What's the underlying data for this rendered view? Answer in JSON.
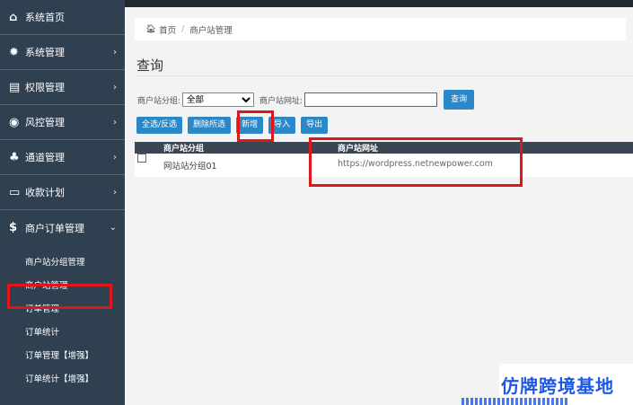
{
  "sidebar": {
    "items": [
      {
        "label": "系统首页",
        "icon": "home-icon"
      },
      {
        "label": "系统管理",
        "icon": "gear-icon"
      },
      {
        "label": "权限管理",
        "icon": "keyboard-icon"
      },
      {
        "label": "风控管理",
        "icon": "target-icon"
      },
      {
        "label": "通道管理",
        "icon": "sitemap-icon"
      },
      {
        "label": "收款计划",
        "icon": "calendar-icon"
      },
      {
        "label": "商户订单管理",
        "icon": "dollar-circle-icon"
      }
    ],
    "sub_items": [
      {
        "label": "商户站分组管理"
      },
      {
        "label": "商户站管理"
      },
      {
        "label": "订单管理"
      },
      {
        "label": "订单统计"
      },
      {
        "label": "订单管理【增强】"
      },
      {
        "label": "订单统计【增强】"
      }
    ],
    "chevron_right": "›",
    "chevron_down": "⌄"
  },
  "breadcrumb": {
    "home": "首页",
    "separator": "/",
    "current": "商户站管理"
  },
  "page_title": "查询",
  "filter": {
    "group_label": "商户站分组:",
    "group_selected": "全部",
    "url_label": "商户站网址:",
    "url_value": "",
    "search_button": "查询"
  },
  "toolbar": {
    "select_all": "全选/反选",
    "delete_selected": "删除所选",
    "add_new": "新增",
    "import": "导入",
    "export": "导出"
  },
  "table": {
    "columns": [
      "商户站分组",
      "商户站网址"
    ],
    "rows": [
      {
        "group": "网站站分组01",
        "url": "https://wordpress.netnewpower.com"
      }
    ]
  },
  "watermark": {
    "text": "仿牌跨境基地"
  },
  "colors": {
    "sidebar_bg": "#2f4050",
    "accent_blue": "#2a88c8",
    "highlight_red": "#e0161c",
    "watermark_blue": "#1d57e8"
  }
}
